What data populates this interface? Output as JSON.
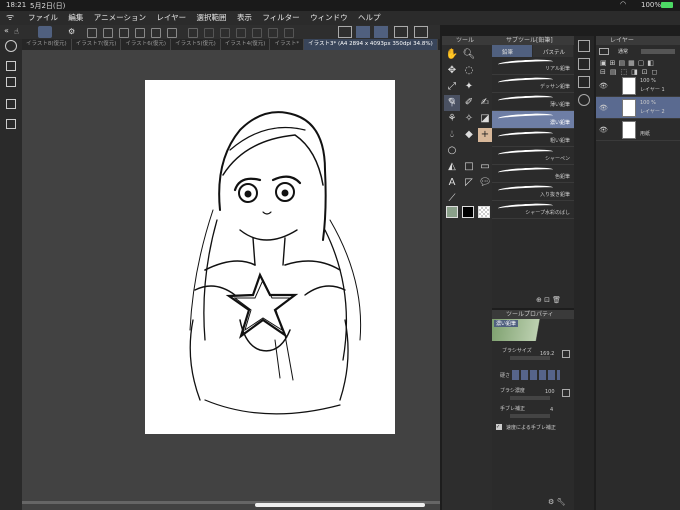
{
  "status": {
    "time": "18:21",
    "date": "5月2日(日)",
    "battery": "100%"
  },
  "menu": [
    "ファイル",
    "編集",
    "アニメーション",
    "レイヤー",
    "選択範囲",
    "表示",
    "フィルター",
    "ウィンドウ",
    "ヘルプ"
  ],
  "tabs": [
    {
      "label": "イラスト8(復元)"
    },
    {
      "label": "イラスト7(復元)"
    },
    {
      "label": "イラスト6(復元)"
    },
    {
      "label": "イラスト5(復元)"
    },
    {
      "label": "イラスト4(復元)"
    },
    {
      "label": "イラスト*"
    },
    {
      "label": "イラスト3* (A4 2894 x 4093px 350dpi 34.8%)"
    }
  ],
  "panels": {
    "tool": "ツール",
    "subtool": "サブツール[鉛筆]",
    "toolprop": "ツールプロパティ",
    "layer": "レイヤー"
  },
  "subtool": {
    "tabs": [
      "鉛筆",
      "パステル"
    ],
    "items": [
      "リアル鉛筆",
      "デッサン鉛筆",
      "薄い鉛筆",
      "濃い鉛筆",
      "粗い鉛筆",
      "シャーペン",
      "色鉛筆",
      "入り抜き鉛筆",
      "シャープ水彩のばし"
    ]
  },
  "toolprop": {
    "title": "濃い鉛筆",
    "brush_size_label": "ブラシサイズ",
    "brush_size": "169.2",
    "hardness_label": "硬さ",
    "density_label": "ブラシ濃度",
    "density": "100",
    "stabilize_label": "手ブレ補正",
    "stabilize": "4",
    "speed_label": "速度による手ブレ補正"
  },
  "layers": {
    "blend": "通常",
    "items": [
      {
        "opacity": "100 %",
        "name": "レイヤー 1"
      },
      {
        "opacity": "100 %",
        "name": "レイヤー 2"
      },
      {
        "opacity": "",
        "name": "用紙"
      }
    ]
  },
  "colors": {
    "accent": "#6e7ea5",
    "main_color": "#8aa08a",
    "sub_color": "#000000"
  }
}
